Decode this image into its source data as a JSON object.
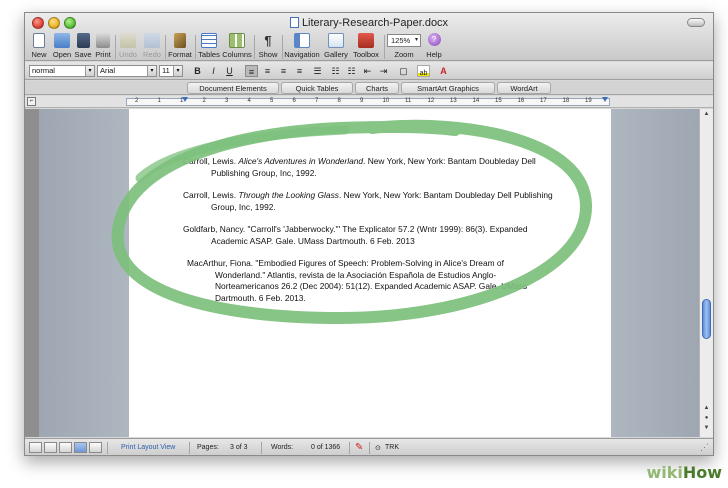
{
  "window": {
    "title": "Literary-Research-Paper.docx"
  },
  "toolbar": {
    "buttons": [
      {
        "label": "New",
        "icon": "new-document-icon"
      },
      {
        "label": "Open",
        "icon": "folder-icon"
      },
      {
        "label": "Save",
        "icon": "floppy-disk-icon"
      },
      {
        "label": "Print",
        "icon": "printer-icon"
      },
      {
        "label": "Undo",
        "icon": "undo-icon"
      },
      {
        "label": "Redo",
        "icon": "redo-icon"
      },
      {
        "label": "Format",
        "icon": "paintbrush-icon"
      },
      {
        "label": "Tables",
        "icon": "table-icon"
      },
      {
        "label": "Columns",
        "icon": "columns-icon"
      },
      {
        "label": "Show",
        "icon": "pilcrow-icon"
      },
      {
        "label": "Navigation",
        "icon": "navigation-pane-icon"
      },
      {
        "label": "Gallery",
        "icon": "gallery-icon"
      },
      {
        "label": "Toolbox",
        "icon": "toolbox-icon"
      },
      {
        "label": "Zoom",
        "icon": "zoom-icon"
      },
      {
        "label": "Help",
        "icon": "help-icon"
      }
    ],
    "zoom_value": "125%"
  },
  "formatting": {
    "style": "normal",
    "font": "Arial",
    "size": "11",
    "bold": "B",
    "italic": "I",
    "underline": "U"
  },
  "gallery_tabs": [
    "Document Elements",
    "Quick Tables",
    "Charts",
    "SmartArt Graphics",
    "WordArt"
  ],
  "ruler": {
    "labels": [
      "2",
      "1",
      "1",
      "2",
      "3",
      "4",
      "5",
      "6",
      "7",
      "8",
      "9",
      "10",
      "11",
      "12",
      "13",
      "14",
      "15",
      "16",
      "17",
      "18",
      "19"
    ]
  },
  "document": {
    "citations": [
      {
        "before": "Carroll, Lewis. ",
        "title": "Alice's Adventures in Wonderland",
        "after": ". New York, New York: Bantam Doubleday Dell Publishing Group, Inc, 1992."
      },
      {
        "before": "Carroll, Lewis. ",
        "title": "Through the Looking Glass",
        "after": ". New York, New York: Bantam Doubleday Dell Publishing Group, Inc, 1992."
      },
      {
        "before": "Goldfarb, Nancy. \"Carroll's 'Jabberwocky.'\" The Explicator 57.2 (Wntr 1999): 86(3). Expanded Academic ASAP. Gale. UMass Dartmouth. 6 Feb. 2013",
        "title": "",
        "after": ""
      },
      {
        "before": "MacArthur, Fiona. \"Embodied Figures of Speech: Problem-Solving in Alice's Dream of Wonderland.\" Atlantis, revista de la Asociación Española de Estudios Anglo-Norteamericanos 26.2 (Dec 2004): 51(12). Expanded Academic ASAP. Gale. UMass Dartmouth. 6 Feb. 2013.",
        "title": "",
        "after": ""
      }
    ]
  },
  "statusbar": {
    "view_name": "Print Layout View",
    "pages_label": "Pages:",
    "pages_value": "3 of 3",
    "words_label": "Words:",
    "words_value": "0 of 1366",
    "track_label": "TRK"
  },
  "watermark": {
    "wiki": "wiki",
    "how": "How"
  },
  "colors": {
    "annotation_circle": "#7cc07c",
    "accent": "#3d6fb8"
  }
}
